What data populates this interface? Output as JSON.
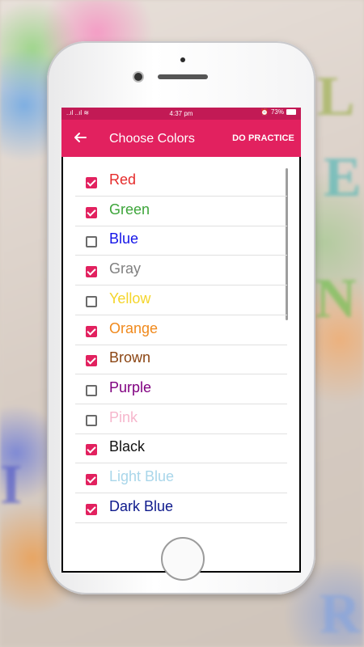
{
  "status_bar": {
    "left": "..ıl ..ıl ≋",
    "time": "4:37 pm",
    "battery": "73%"
  },
  "app_bar": {
    "title": "Choose Colors",
    "action_label": "DO PRACTICE"
  },
  "colors": [
    {
      "label": "Red",
      "checked": true,
      "color": "#e52b2b"
    },
    {
      "label": "Green",
      "checked": true,
      "color": "#3da53a"
    },
    {
      "label": "Blue",
      "checked": false,
      "color": "#1414e8"
    },
    {
      "label": "Gray",
      "checked": true,
      "color": "#808080"
    },
    {
      "label": "Yellow",
      "checked": false,
      "color": "#f4d52a"
    },
    {
      "label": "Orange",
      "checked": true,
      "color": "#f0891c"
    },
    {
      "label": "Brown",
      "checked": true,
      "color": "#8b4513"
    },
    {
      "label": "Purple",
      "checked": false,
      "color": "#800080"
    },
    {
      "label": "Pink",
      "checked": false,
      "color": "#f6b6cc"
    },
    {
      "label": "Black",
      "checked": true,
      "color": "#111111"
    },
    {
      "label": "Light Blue",
      "checked": true,
      "color": "#a9d6ea"
    },
    {
      "label": "Dark Blue",
      "checked": true,
      "color": "#0e1a8c"
    }
  ],
  "theme": {
    "accent": "#e2215f",
    "status_bar": "#c21a55"
  }
}
